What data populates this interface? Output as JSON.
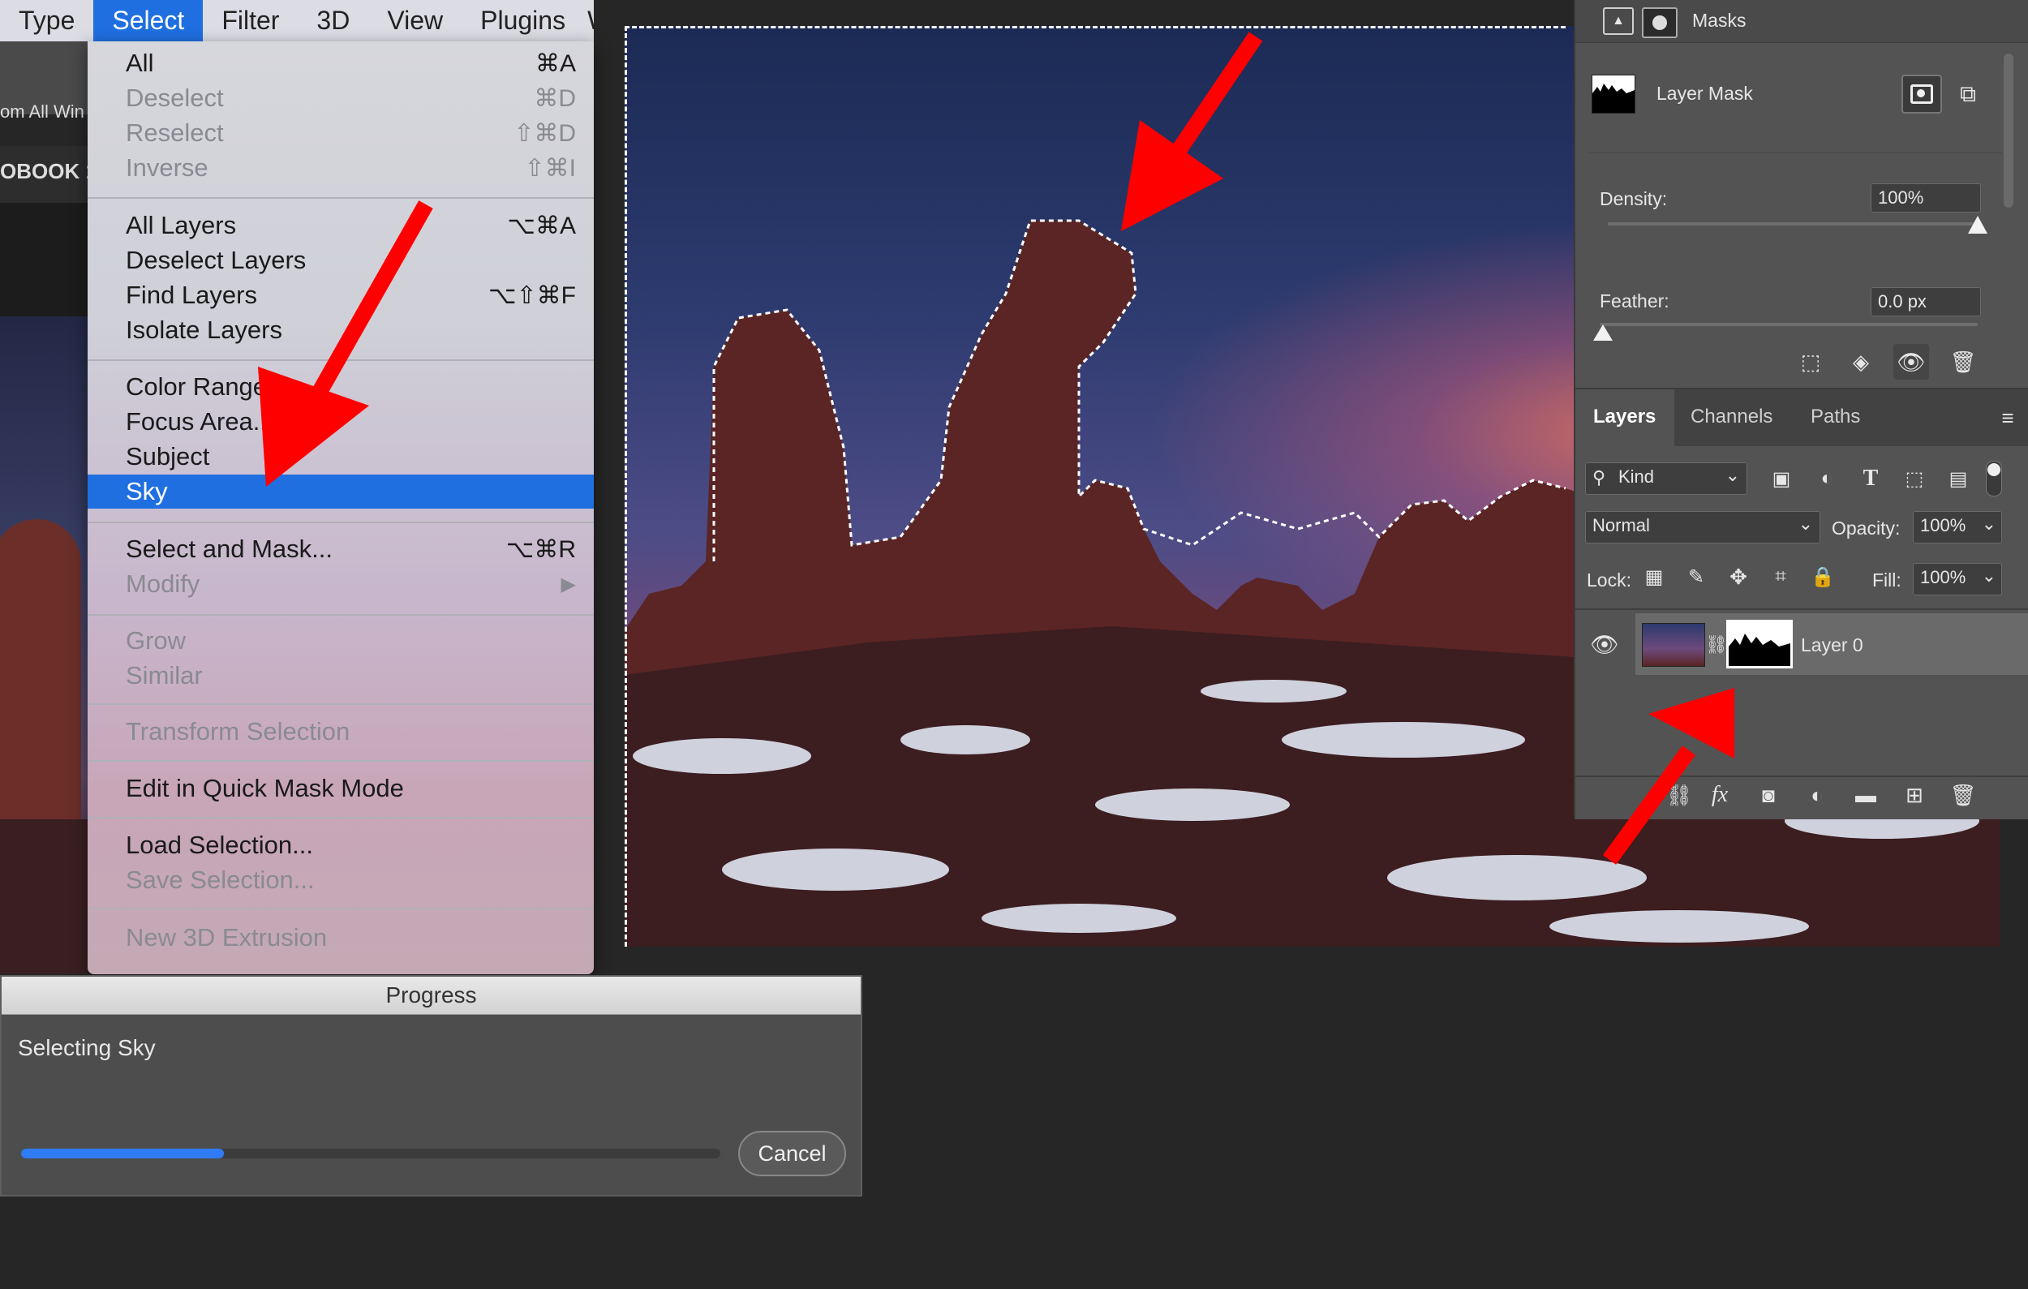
{
  "menubar": {
    "items": [
      "Type",
      "Select",
      "Filter",
      "3D",
      "View",
      "Plugins",
      "W"
    ],
    "active_index": 1
  },
  "left_strip": {
    "window_text": "om All Win",
    "tab_text": "OBOOK 1"
  },
  "select_menu": {
    "items": [
      {
        "label": "All",
        "shortcut": "⌘A",
        "disabled": false
      },
      {
        "label": "Deselect",
        "shortcut": "⌘D",
        "disabled": true
      },
      {
        "label": "Reselect",
        "shortcut": "⇧⌘D",
        "disabled": true
      },
      {
        "label": "Inverse",
        "shortcut": "⇧⌘I",
        "disabled": true
      },
      {
        "label": "All Layers",
        "shortcut": "⌥⌘A",
        "disabled": false
      },
      {
        "label": "Deselect Layers",
        "shortcut": "",
        "disabled": false
      },
      {
        "label": "Find Layers",
        "shortcut": "⌥⇧⌘F",
        "disabled": false
      },
      {
        "label": "Isolate Layers",
        "shortcut": "",
        "disabled": false
      },
      {
        "label": "Color Range",
        "shortcut": "",
        "disabled": false
      },
      {
        "label": "Focus Area...",
        "shortcut": "",
        "disabled": false
      },
      {
        "label": "Subject",
        "shortcut": "",
        "disabled": false
      },
      {
        "label": "Sky",
        "shortcut": "",
        "disabled": false,
        "highlighted": true
      },
      {
        "label": "Select and Mask...",
        "shortcut": "⌥⌘R",
        "disabled": false
      },
      {
        "label": "Modify",
        "shortcut": "▶",
        "disabled": true
      },
      {
        "label": "Grow",
        "shortcut": "",
        "disabled": true
      },
      {
        "label": "Similar",
        "shortcut": "",
        "disabled": true
      },
      {
        "label": "Transform Selection",
        "shortcut": "",
        "disabled": true
      },
      {
        "label": "Edit in Quick Mask Mode",
        "shortcut": "",
        "disabled": false
      },
      {
        "label": "Load Selection...",
        "shortcut": "",
        "disabled": false
      },
      {
        "label": "Save Selection...",
        "shortcut": "",
        "disabled": true
      },
      {
        "label": "New 3D Extrusion",
        "shortcut": "",
        "disabled": true
      }
    ]
  },
  "properties_panel": {
    "header": "Masks",
    "mask_label": "Layer Mask",
    "density_label": "Density:",
    "density_value": "100%",
    "density_fraction": 1.0,
    "feather_label": "Feather:",
    "feather_value": "0.0 px",
    "feather_fraction": 0.0
  },
  "layers_panel": {
    "tabs": [
      "Layers",
      "Channels",
      "Paths"
    ],
    "active_tab": 0,
    "filter_kind": "Kind",
    "blend_mode": "Normal",
    "opacity_label": "Opacity:",
    "opacity_value": "100%",
    "lock_label": "Lock:",
    "fill_label": "Fill:",
    "fill_value": "100%",
    "layer_name": "Layer 0"
  },
  "progress_dialog": {
    "title": "Progress",
    "message": "Selecting Sky",
    "progress_fraction": 0.29,
    "cancel_label": "Cancel"
  },
  "colors": {
    "accent": "#1f6fe0",
    "progress_fill": "#2f7cf6",
    "arrow": "#ff0000",
    "panel_bg": "#535353"
  }
}
